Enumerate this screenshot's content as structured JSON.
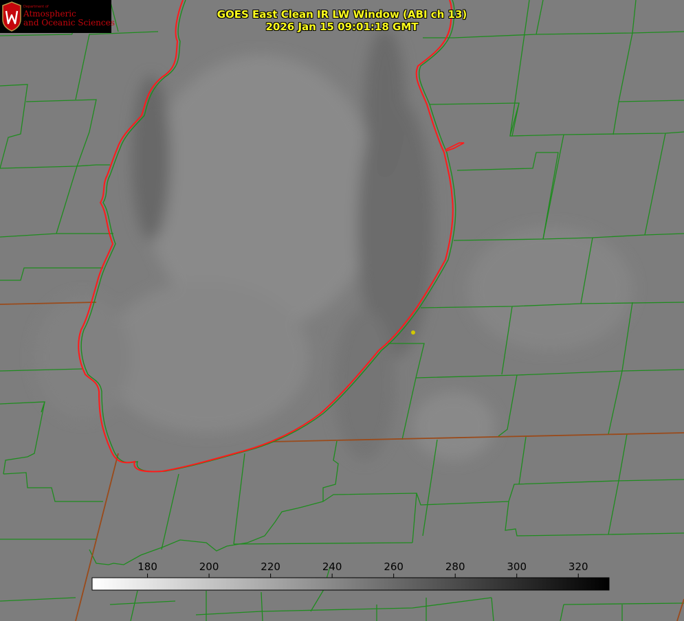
{
  "logo": {
    "department": "Department of",
    "line1": "Atmospheric",
    "line2": "and Oceanic Sciences"
  },
  "title": {
    "line1": "GOES East Clean IR LW Window (ABI ch 13)",
    "line2": "2026 Jan 15 09:01:18 GMT"
  },
  "colorbar": {
    "ticks": [
      "180",
      "200",
      "220",
      "240",
      "260",
      "280",
      "300",
      "320"
    ],
    "min": 162,
    "max": 330,
    "colors": {
      "low": "#ffffff",
      "high": "#000000"
    }
  },
  "colors": {
    "background": "#7e7e7e",
    "county_lines": "#1e8c1e",
    "state_lines": "#9a4a1a",
    "coastline": "#ff1a1a",
    "marker": "#d2c800",
    "title_text": "#ffff1e",
    "logo_text": "#c5050c"
  }
}
